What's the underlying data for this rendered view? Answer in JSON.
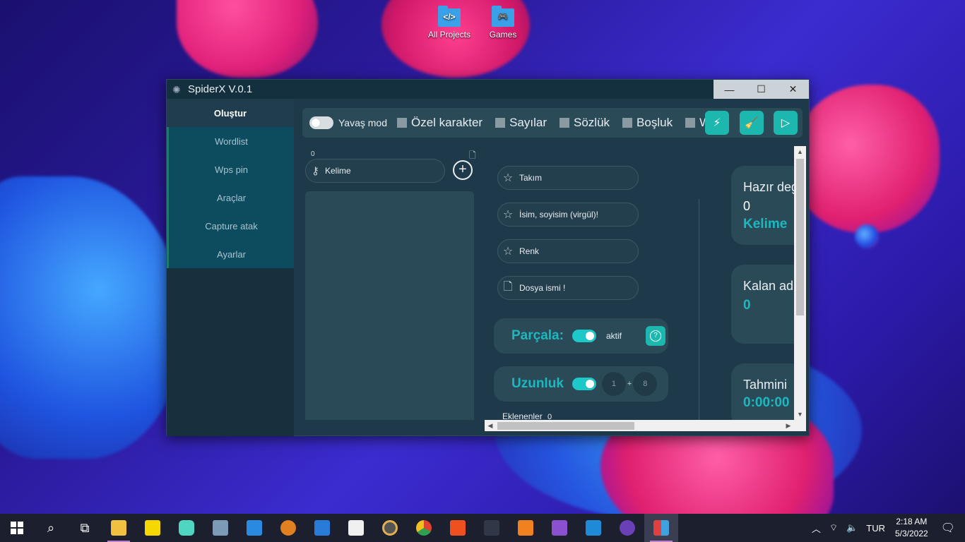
{
  "desktop": {
    "icons": [
      {
        "label": "All Projects",
        "glyph": "</>",
        "icon": "folder-code-icon"
      },
      {
        "label": "Games",
        "glyph": "🎮",
        "icon": "folder-games-icon"
      }
    ]
  },
  "window": {
    "title": "SpiderX V.0.1",
    "controls": {
      "minimize": "—",
      "maximize": "☐",
      "close": "✕"
    }
  },
  "sidebar": {
    "items": [
      {
        "label": "Oluştur",
        "active": true
      },
      {
        "label": "Wordlist"
      },
      {
        "label": "Wps pin"
      },
      {
        "label": "Araçlar"
      },
      {
        "label": "Capture atak"
      },
      {
        "label": "Ayarlar"
      }
    ]
  },
  "toolbar": {
    "slow_mode_label": "Yavaş mod",
    "checkboxes": [
      "Özel karakter",
      "Sayılar",
      "Sözlük",
      "Boşluk",
      "W"
    ],
    "actions": {
      "lightning": "⚡",
      "broom": "🧹",
      "play": "▷"
    }
  },
  "main": {
    "word_count": "0",
    "kelime_placeholder": "Kelime",
    "add_symbol": "+",
    "fields": [
      {
        "label": "Takım",
        "icon": "star-icon",
        "glyph": "☆"
      },
      {
        "label": "İsim, soyisim (virgül)!",
        "icon": "star-icon",
        "glyph": "☆"
      },
      {
        "label": "Renk",
        "icon": "star-icon",
        "glyph": "☆"
      },
      {
        "label": "Dosya ismi !",
        "icon": "file-icon",
        "glyph": "🗋"
      }
    ],
    "parcala": {
      "title": "Parçala:",
      "status": "aktif",
      "help": "?"
    },
    "uzunluk": {
      "title": "Uzunluk",
      "min": "1",
      "plus": "+",
      "max": "8"
    },
    "eklenenler": {
      "label": "Eklenenler",
      "count": "0"
    }
  },
  "stats": [
    {
      "label": "Hazır deg",
      "value": "0",
      "accent": "Kelime"
    },
    {
      "label": "Kalan ad",
      "value": "",
      "accent": "0"
    },
    {
      "label": "Tahmini",
      "value": "",
      "accent": "0:00:00"
    }
  ],
  "taskbar": {
    "tray": {
      "language": "TUR",
      "time": "2:18 AM",
      "date": "5/3/2022"
    }
  },
  "colors": {
    "accent": "#1cb8c0",
    "panel": "#2b4a58",
    "sidebar_active": "#0d4b5f"
  }
}
